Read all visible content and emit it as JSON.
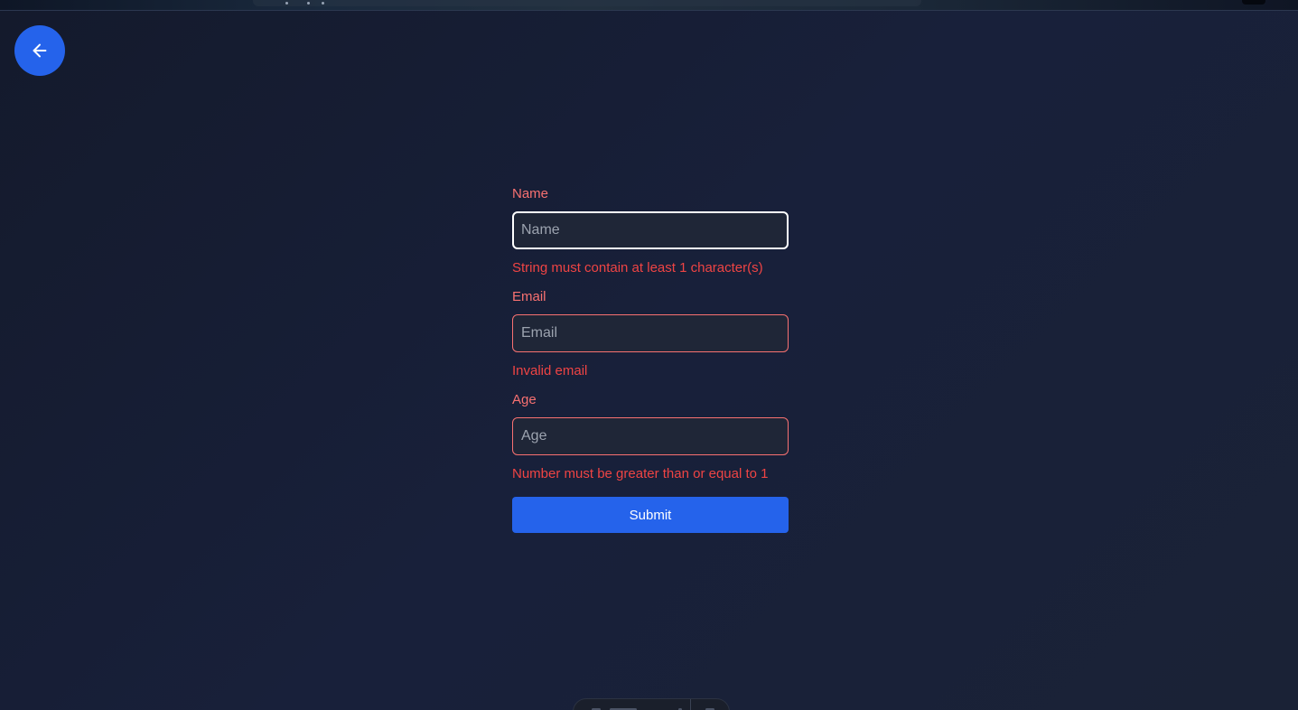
{
  "colors": {
    "accent": "#2563eb",
    "error": "#ef4444",
    "label": "#f87171",
    "background": "#161d2f"
  },
  "back_button": {
    "icon": "arrow-left-icon"
  },
  "form": {
    "fields": [
      {
        "label": "Name",
        "placeholder": "Name",
        "value": "",
        "error": "String must contain at least 1 character(s)",
        "focused": true
      },
      {
        "label": "Email",
        "placeholder": "Email",
        "value": "",
        "error": "Invalid email",
        "focused": false
      },
      {
        "label": "Age",
        "placeholder": "Age",
        "value": "",
        "error": "Number must be greater than or equal to 1",
        "focused": false
      }
    ],
    "submit_label": "Submit"
  }
}
